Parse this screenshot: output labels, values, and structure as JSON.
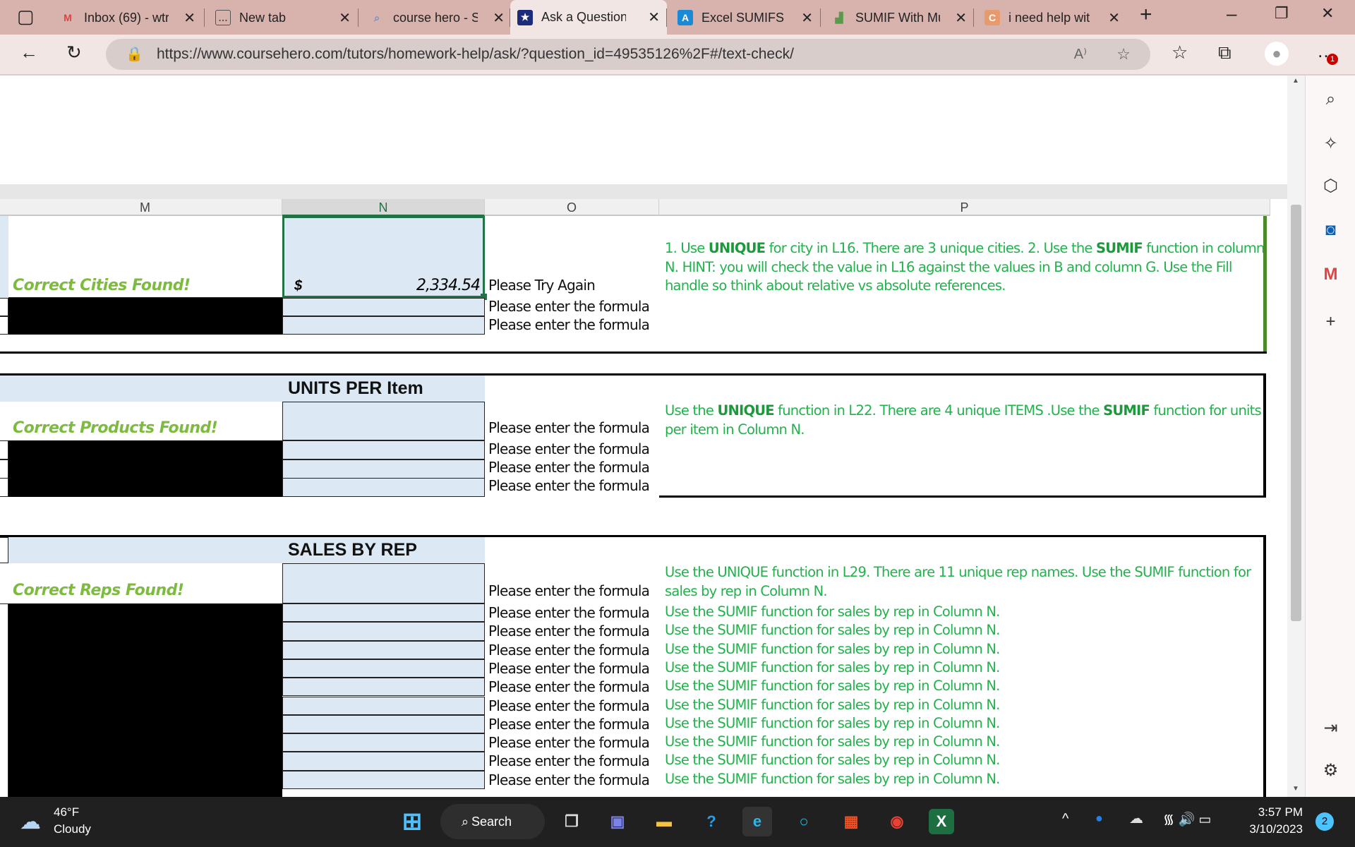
{
  "browser": {
    "tabs": [
      {
        "label": "Inbox (69) - wtr",
        "icon": "gmail-icon",
        "active": false
      },
      {
        "label": "New tab",
        "icon": "new-tab-icon",
        "active": false
      },
      {
        "label": "course hero - S",
        "icon": "search-icon",
        "active": false
      },
      {
        "label": "Ask a Question",
        "icon": "coursehero-icon",
        "active": true
      },
      {
        "label": "Excel SUMIFS a",
        "icon": "a-icon",
        "active": false
      },
      {
        "label": "SUMIF With Mu",
        "icon": "site-icon",
        "active": false
      },
      {
        "label": "i need help wit",
        "icon": "c-icon",
        "active": false
      }
    ],
    "url": "https://www.coursehero.com/tutors/homework-help/ask/?question_id=49535126%2F#/text-check/",
    "notification_badge": "1"
  },
  "sheet": {
    "columns": [
      "M",
      "N",
      "O",
      "P"
    ],
    "section1": {
      "status": "Correct Cities Found!",
      "currency": "$",
      "value": "2,334.54",
      "o_values": [
        "Please Try Again",
        "Please enter the formula",
        "Please enter the formula"
      ],
      "note_html": "1. Use <b>UNIQUE</b> for city in L16. There are 3 unique cities. 2. Use the <b>SUMIF</b> function in column N. HINT: you will check the value in L16 against the values in B and column G. Use the Fill handle so think about relative vs absolute references."
    },
    "section2": {
      "header": "UNITS PER Item",
      "status": "Correct Products Found!",
      "o_values": [
        "Please enter the formula",
        "Please enter the formula",
        "Please enter the formula",
        "Please enter the formula"
      ],
      "note_html": "Use the <b>UNIQUE</b> function in L22. There are 4 unique ITEMS .Use the <b>SUMIF</b> function for units per item in Column N."
    },
    "section3": {
      "header": "SALES BY REP",
      "status": "Correct Reps Found!",
      "o_values": [
        "Please enter the formula",
        "Please enter the formula",
        "Please enter the formula",
        "Please enter the formula",
        "Please enter the formula",
        "Please enter the formula",
        "Please enter the formula",
        "Please enter the formula",
        "Please enter the formula",
        "Please enter the formula",
        "Please enter the formula"
      ],
      "first_note": "Use the UNIQUE function in L29. There are 11 unique rep names. Use the SUMIF function for sales by rep in Column N.",
      "row_note": "Use the SUMIF function for sales by rep in Column N."
    }
  },
  "taskbar": {
    "weather_temp": "46°F",
    "weather_desc": "Cloudy",
    "search_label": "Search",
    "time": "3:57 PM",
    "date": "3/10/2023",
    "notification_count": "2"
  },
  "colors": {
    "accent_green": "#22b24c",
    "status_green": "#7dbb3f",
    "cell_blue": "#dce9f5",
    "selection": "#217346"
  }
}
